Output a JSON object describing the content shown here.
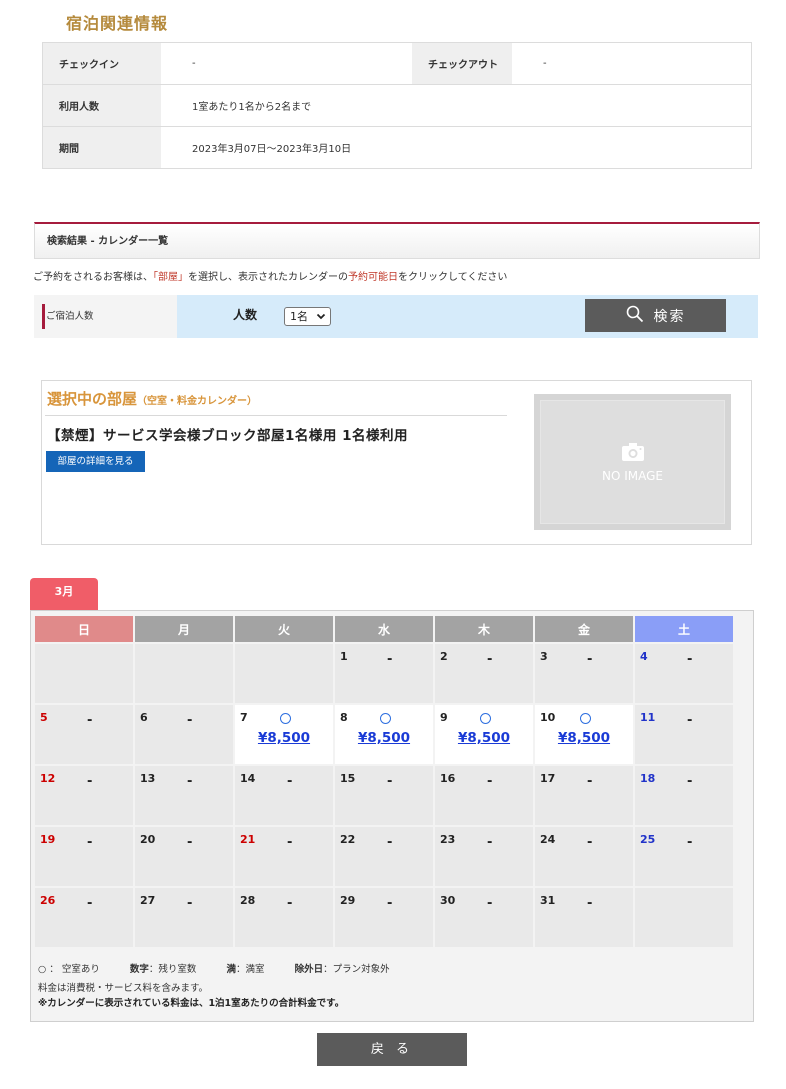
{
  "lodging": {
    "title": "宿泊関連情報",
    "checkin_label": "チェックイン",
    "checkin_value": "-",
    "checkout_label": "チェックアウト",
    "checkout_value": "-",
    "guests_label": "利用人数",
    "guests_value": "1室あたり1名から2名まで",
    "period_label": "期間",
    "period_value": "2023年3月07日～2023年3月10日"
  },
  "results": {
    "header": "検索結果 - カレンダー一覧",
    "notice_pre": "ご予約をされるお客様は、",
    "notice_room": "「部屋」",
    "notice_mid": "を選択し、表示されたカレンダーの",
    "notice_avail": "予約可能日",
    "notice_post": "をクリックしてください"
  },
  "search": {
    "guests_label": "ご宿泊人数",
    "people_label": "人数",
    "people_selected": "1名",
    "button_label": "検索"
  },
  "room": {
    "section_title": "選択中の部屋",
    "section_sub": "（空室・料金カレンダー）",
    "name": "【禁煙】サービス学会様ブロック部屋1名様用 1名様利用",
    "detail_button": "部屋の詳細を見る",
    "no_image": "NO IMAGE"
  },
  "calendar": {
    "month": "3月",
    "weekdays": [
      "日",
      "月",
      "火",
      "水",
      "木",
      "金",
      "土"
    ],
    "weekday_colors": [
      "#e08a8a",
      "#a3a3a3",
      "#a3a3a3",
      "#a3a3a3",
      "#a3a3a3",
      "#a3a3a3",
      "#8a9ef7"
    ],
    "weeks": [
      [
        {
          "d": ""
        },
        {
          "d": ""
        },
        {
          "d": ""
        },
        {
          "d": "1",
          "s": "-"
        },
        {
          "d": "2",
          "s": "-"
        },
        {
          "d": "3",
          "s": "-"
        },
        {
          "d": "4",
          "s": "-"
        }
      ],
      [
        {
          "d": "5",
          "s": "-"
        },
        {
          "d": "6",
          "s": "-"
        },
        {
          "d": "7",
          "p": "¥8,500"
        },
        {
          "d": "8",
          "p": "¥8,500"
        },
        {
          "d": "9",
          "p": "¥8,500"
        },
        {
          "d": "10",
          "p": "¥8,500"
        },
        {
          "d": "11",
          "s": "-"
        }
      ],
      [
        {
          "d": "12",
          "s": "-"
        },
        {
          "d": "13",
          "s": "-"
        },
        {
          "d": "14",
          "s": "-"
        },
        {
          "d": "15",
          "s": "-"
        },
        {
          "d": "16",
          "s": "-"
        },
        {
          "d": "17",
          "s": "-"
        },
        {
          "d": "18",
          "s": "-"
        }
      ],
      [
        {
          "d": "19",
          "s": "-"
        },
        {
          "d": "20",
          "s": "-"
        },
        {
          "d": "21",
          "s": "-",
          "h": true
        },
        {
          "d": "22",
          "s": "-"
        },
        {
          "d": "23",
          "s": "-"
        },
        {
          "d": "24",
          "s": "-"
        },
        {
          "d": "25",
          "s": "-"
        }
      ],
      [
        {
          "d": "26",
          "s": "-"
        },
        {
          "d": "27",
          "s": "-"
        },
        {
          "d": "28",
          "s": "-"
        },
        {
          "d": "29",
          "s": "-"
        },
        {
          "d": "30",
          "s": "-"
        },
        {
          "d": "31",
          "s": "-"
        },
        {
          "d": ""
        }
      ]
    ]
  },
  "legend": {
    "avail": "○ ： 空室あり",
    "num_label": "数字",
    "num_text": "：残り室数",
    "full_label": "満",
    "full_text": "：満室",
    "excl_label": "除外日",
    "excl_text": "：プラン対象外",
    "tax_note": "料金は消費税・サービス料を含みます。",
    "price_note": "※カレンダーに表示されている料金は、1泊1室あたりの合計料金です。"
  },
  "back_button": "戻 る"
}
